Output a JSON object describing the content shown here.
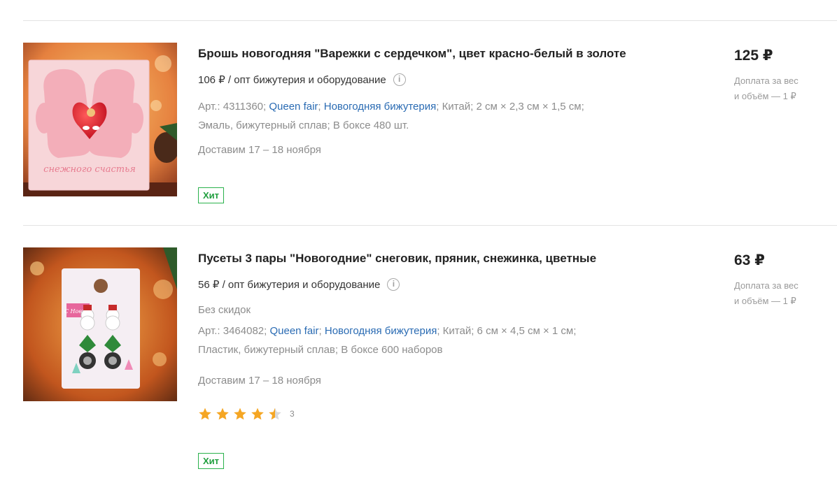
{
  "products": [
    {
      "title": "Брошь новогодняя \"Варежки с сердечком\", цвет красно-белый в золоте",
      "wholesale": "106 ₽ / опт бижутерия и оборудование",
      "art": "Арт.: 4311360;",
      "brand": "Queen fair",
      "semi": ";",
      "category": "Новогодняя бижутерия",
      "rest_line1": "; Китай; 2 см × 2,3 см × 1,5 см;",
      "line2": "Эмаль, бижутерный сплав; В боксе 480 шт.",
      "delivery": "Доставим 17 – 18 ноября",
      "badge": "Хит",
      "price": "125 ₽",
      "extra_line1": "Доплата за вес",
      "extra_line2": "и объём — 1 ₽",
      "image_text": "снежного счастья"
    },
    {
      "title": "Пусеты 3 пары \"Новогодние\" снеговик, пряник, снежинка, цветные",
      "wholesale": "56 ₽ / опт бижутерия и оборудование",
      "discount": "Без скидок",
      "art": "Арт.: 3464082;",
      "brand": "Queen fair",
      "semi": ";",
      "category": "Новогодняя бижутерия",
      "rest_line1": "; Китай; 6 см × 4,5 см × 1 см;",
      "line2": "Пластик, бижутерный сплав; В боксе 600 наборов",
      "delivery": "Доставим 17 – 18 ноября",
      "rating": 4.5,
      "reviews": "3",
      "badge": "Хит",
      "price": "63 ₽",
      "extra_line1": "Доплата за вес",
      "extra_line2": "и объём — 1 ₽",
      "image_text": "С Новым"
    }
  ],
  "colors": {
    "link": "#2a6bb3",
    "badge_green": "#2bb24c",
    "star": "#f5a623"
  }
}
